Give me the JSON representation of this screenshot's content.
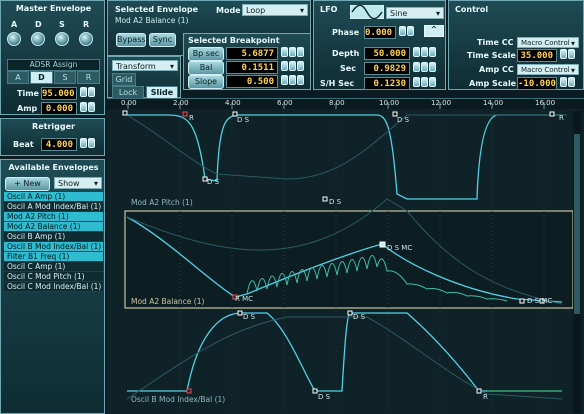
{
  "master_envelope": {
    "title": "Master Envelope",
    "knobs": [
      "A",
      "D",
      "S",
      "R"
    ],
    "adsr_assign_label": "ADSR Assign",
    "adsr_tabs": [
      "A",
      "D",
      "S",
      "R"
    ],
    "time_label": "Time",
    "time_value": "95.000",
    "amp_label": "Amp",
    "amp_value": "0.000"
  },
  "retrigger": {
    "title": "Retrigger",
    "beat_label": "Beat",
    "beat_value": "4.000"
  },
  "available_envelopes": {
    "title": "Available Envelopes",
    "new_label": "+ New",
    "show_label": "Show",
    "items": [
      {
        "label": "Oscil A Amp (1)",
        "highlight": true
      },
      {
        "label": "Oscil A Mod Index/Bal (1)",
        "highlight": false
      },
      {
        "label": "Mod A2 Pitch (1)",
        "highlight": true
      },
      {
        "label": "Mod A2 Balance (1)",
        "highlight": true
      },
      {
        "label": "Oscil B Amp (1)",
        "highlight": false
      },
      {
        "label": "Oscil B Mod Index/Bal (1)",
        "highlight": true
      },
      {
        "label": "Filter B1 Freq (1)",
        "highlight": true
      },
      {
        "label": "Oscil C Amp (1)",
        "highlight": false
      },
      {
        "label": "Oscil C Mod Pitch (1)",
        "highlight": false
      },
      {
        "label": "Oscil C Mod Index/Bal (1)",
        "highlight": false
      }
    ]
  },
  "selected_envelope": {
    "title": "Selected Envelope",
    "name": "Mod A2 Balance (1)",
    "mode_label": "Mode",
    "mode_value": "Loop",
    "bypass_label": "Bypass",
    "sync_label": "Sync"
  },
  "selected_breakpoint": {
    "title": "Selected Breakpoint",
    "rows": [
      {
        "label": "Bp sec",
        "value": "5.6877"
      },
      {
        "label": "Bal",
        "value": "0.1511"
      },
      {
        "label": "Slope",
        "value": "0.500"
      }
    ]
  },
  "lfo": {
    "title": "LFO",
    "wave_value": "Sine",
    "phase_label": "Phase",
    "phase_value": "0.000",
    "rows": [
      {
        "label": "Depth",
        "value": "50.000"
      },
      {
        "label": "Sec",
        "value": "0.9829"
      },
      {
        "label": "S/H Sec",
        "value": "0.1230"
      }
    ]
  },
  "control": {
    "title": "Control",
    "time_cc_label": "Time CC",
    "time_cc_value": "Macro Control",
    "time_scale_label": "Time Scale",
    "time_scale_value": "35.000",
    "amp_cc_label": "Amp CC",
    "amp_cc_value": "Macro Control",
    "amp_scale_label": "Amp Scale",
    "amp_scale_value": "-10.000"
  },
  "editor_tools": {
    "transform_label": "Transform",
    "grid_label": "Grid",
    "lock_label": "Lock",
    "slide_label": "Slide"
  },
  "ruler": {
    "ticks": [
      "0.00",
      "2.00",
      "4.00",
      "6.00",
      "8.00",
      "10.00",
      "12.00",
      "14.00",
      "16.00"
    ]
  },
  "lanes": [
    {
      "name": "Mod A2 Pitch (1)"
    },
    {
      "name": "Mod A2 Balance (1)"
    },
    {
      "name": "Oscil B Mod Index/Bal (1)"
    }
  ],
  "breakpoint_labels": {
    "lane1": [
      "R",
      "D S",
      "D S",
      "D S",
      "D S",
      "R"
    ],
    "lane2": [
      "R MC",
      "D S MC",
      "D S MC"
    ],
    "lane3": [
      "D S",
      "D S",
      "D S",
      "R"
    ]
  },
  "colors": {
    "accent": "#2fbcd0",
    "curve": "#4fd2e6",
    "value_text": "#ffd34f"
  }
}
